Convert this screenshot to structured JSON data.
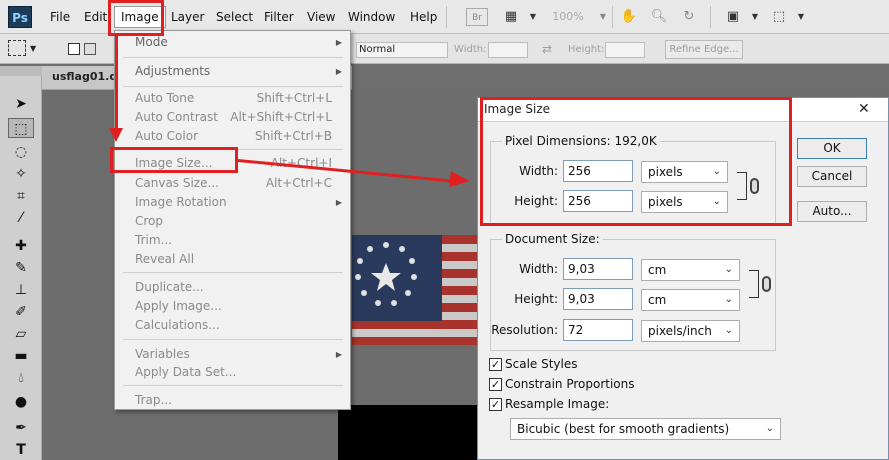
{
  "menubar": {
    "logo": "Ps",
    "items": [
      "File",
      "Edit",
      "Image",
      "Layer",
      "Select",
      "Filter",
      "View",
      "Window",
      "Help"
    ],
    "bridge": "Br",
    "zoom": "100%"
  },
  "options": {
    "style_value": "Normal",
    "width_label": "Width:",
    "height_label": "Height:",
    "refine_edge": "Refine Edge..."
  },
  "document": {
    "tab_title": "usflag01.dds"
  },
  "image_menu": {
    "items": [
      {
        "label": "Mode",
        "shortcut": "",
        "submenu": true
      },
      {
        "label": "Adjustments",
        "shortcut": "",
        "submenu": true
      },
      {
        "label": "Auto Tone",
        "shortcut": "Shift+Ctrl+L"
      },
      {
        "label": "Auto Contrast",
        "shortcut": "Alt+Shift+Ctrl+L"
      },
      {
        "label": "Auto Color",
        "shortcut": "Shift+Ctrl+B"
      },
      {
        "label": "Image Size...",
        "shortcut": "Alt+Ctrl+I"
      },
      {
        "label": "Canvas Size...",
        "shortcut": "Alt+Ctrl+C"
      },
      {
        "label": "Image Rotation",
        "shortcut": "",
        "submenu": true
      },
      {
        "label": "Crop",
        "shortcut": ""
      },
      {
        "label": "Trim...",
        "shortcut": ""
      },
      {
        "label": "Reveal All",
        "shortcut": ""
      },
      {
        "label": "Duplicate...",
        "shortcut": ""
      },
      {
        "label": "Apply Image...",
        "shortcut": ""
      },
      {
        "label": "Calculations...",
        "shortcut": ""
      },
      {
        "label": "Variables",
        "shortcut": "",
        "submenu": true
      },
      {
        "label": "Apply Data Set...",
        "shortcut": ""
      },
      {
        "label": "Trap...",
        "shortcut": ""
      }
    ]
  },
  "dialog": {
    "title": "Image Size",
    "close": "✕",
    "pixel_dimensions_label": "Pixel Dimensions:",
    "pixel_dimensions_size": "192,0K",
    "px_width_label": "Width:",
    "px_width_value": "256",
    "px_width_unit": "pixels",
    "px_height_label": "Height:",
    "px_height_value": "256",
    "px_height_unit": "pixels",
    "document_size_label": "Document Size:",
    "doc_width_label": "Width:",
    "doc_width_value": "9,03",
    "doc_width_unit": "cm",
    "doc_height_label": "Height:",
    "doc_height_value": "9,03",
    "doc_height_unit": "cm",
    "resolution_label": "Resolution:",
    "resolution_value": "72",
    "resolution_unit": "pixels/inch",
    "scale_styles": "Scale Styles",
    "constrain_proportions": "Constrain Proportions",
    "resample_image": "Resample Image:",
    "resample_method": "Bicubic (best for smooth gradients)",
    "ok": "OK",
    "cancel": "Cancel",
    "auto": "Auto..."
  },
  "colors": {
    "highlight": "#e02020",
    "flag_red": "#a8322c",
    "flag_blue": "#2a3a5c"
  }
}
